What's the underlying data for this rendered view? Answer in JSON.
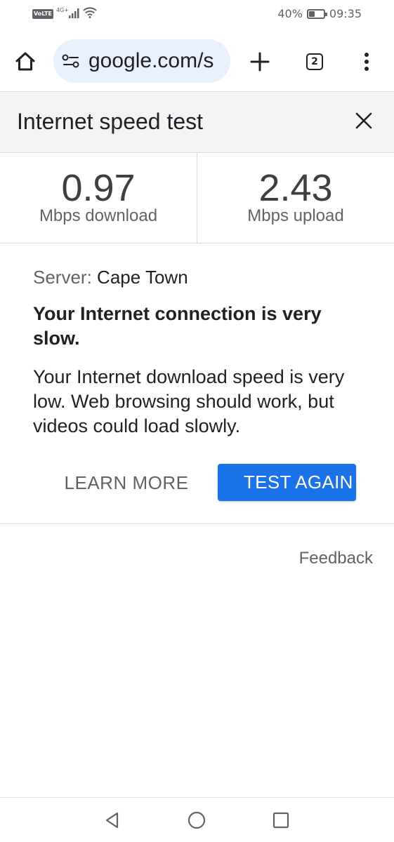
{
  "status_bar": {
    "volte": "VoLTE",
    "network": "4G+",
    "battery_percent": "40%",
    "battery_level": 0.4,
    "time": "09:35"
  },
  "toolbar": {
    "url": "google.com/s",
    "tab_count": "2"
  },
  "panel": {
    "title": "Internet speed test"
  },
  "results": {
    "download_value": "0.97",
    "download_unit": "Mbps download",
    "upload_value": "2.43",
    "upload_unit": "Mbps upload"
  },
  "info": {
    "server_label": "Server:",
    "server_value": "Cape Town",
    "verdict": "Your Internet connection is very slow.",
    "description": "Your Internet download speed is very low. Web browsing should work, but videos could load slowly."
  },
  "actions": {
    "learn_more": "LEARN MORE",
    "test_again": "TEST AGAIN"
  },
  "feedback": "Feedback",
  "colors": {
    "accent": "#1a73e8",
    "url_bar_bg": "#e8f0fe",
    "panel_header_bg": "#f1f3f4"
  }
}
